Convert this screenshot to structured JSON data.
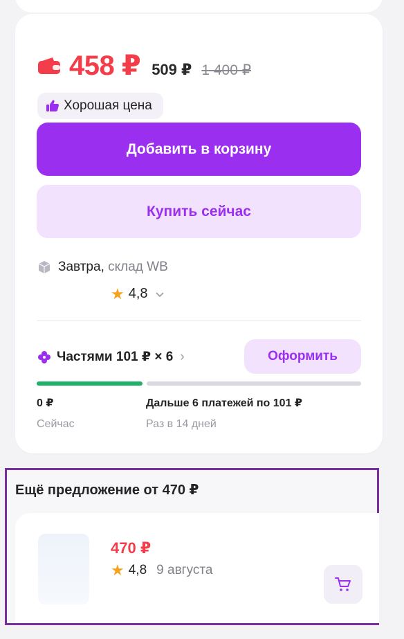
{
  "price": {
    "current": "458 ₽",
    "without_wallet": "509 ₽",
    "old": "1 400 ₽"
  },
  "badge": {
    "label": "Хорошая цена"
  },
  "actions": {
    "add_to_cart": "Добавить в корзину",
    "buy_now": "Купить сейчас"
  },
  "delivery": {
    "day": "Завтра",
    "separator": ",",
    "source": "склад WB",
    "rating": "4,8"
  },
  "installments": {
    "label": "Частями 101 ₽ × 6",
    "arrow": "›",
    "order_button": "Оформить",
    "progress_fraction": 0.33,
    "now_amount": "0 ₽",
    "now_label": "Сейчас",
    "later_amount": "Дальше 6 платежей по 101 ₽",
    "later_label": "Раз в 14 дней"
  },
  "offer": {
    "title": "Ещё предложение от 470 ₽",
    "price": "470 ₽",
    "rating": "4,8",
    "date": "9 августа"
  },
  "colors": {
    "accent": "#9b2ff0",
    "accent_light": "#f2e2fd",
    "price_red": "#f33d4a",
    "success": "#1fb16a",
    "star": "#f6a21d",
    "frame": "#7b2f9e"
  },
  "icons": {
    "wallet": "wallet-icon",
    "good_price": "thumbs-up-icon",
    "delivery": "package-icon",
    "rating": "star-icon",
    "expand": "chevron-down-icon",
    "installments": "clover-icon",
    "cart": "cart-icon"
  }
}
